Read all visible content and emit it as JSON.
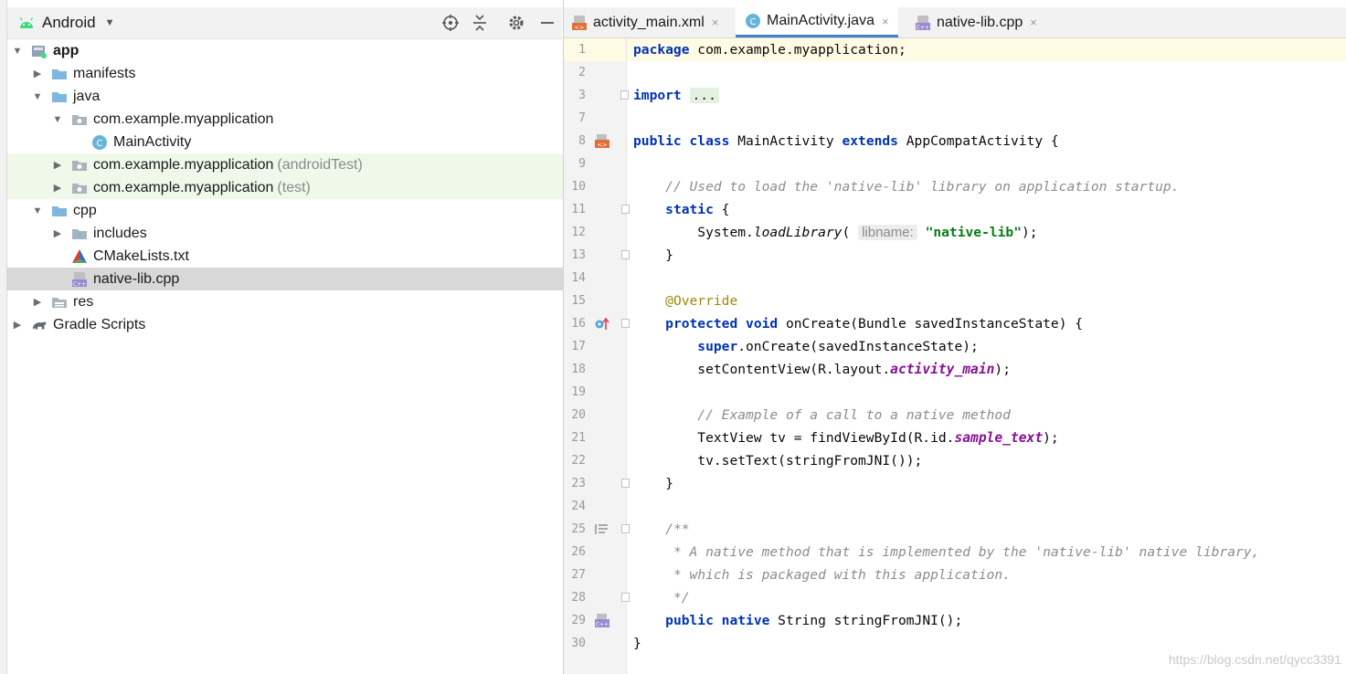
{
  "project_panel": {
    "view_mode": "Android",
    "tree": [
      {
        "label": "app",
        "suffix": "",
        "icon": "module-icon",
        "expanded": true
      },
      {
        "label": "manifests",
        "suffix": "",
        "icon": "folder-icon",
        "expanded": false
      },
      {
        "label": "java",
        "suffix": "",
        "icon": "folder-icon",
        "expanded": true
      },
      {
        "label": "com.example.myapplication",
        "suffix": "",
        "icon": "package-icon",
        "expanded": true
      },
      {
        "label": "MainActivity",
        "suffix": "",
        "icon": "class-icon"
      },
      {
        "label": "com.example.myapplication",
        "suffix": "(androidTest)",
        "icon": "package-icon",
        "expanded": false
      },
      {
        "label": "com.example.myapplication",
        "suffix": "(test)",
        "icon": "package-icon",
        "expanded": false
      },
      {
        "label": "cpp",
        "suffix": "",
        "icon": "folder-icon",
        "expanded": true
      },
      {
        "label": "includes",
        "suffix": "",
        "icon": "package-icon",
        "expanded": false
      },
      {
        "label": "CMakeLists.txt",
        "suffix": "",
        "icon": "cmake-icon"
      },
      {
        "label": "native-lib.cpp",
        "suffix": "",
        "icon": "cpp-file-icon",
        "selected": true
      },
      {
        "label": "res",
        "suffix": "",
        "icon": "res-folder-icon",
        "expanded": false
      },
      {
        "label": "Gradle Scripts",
        "suffix": "",
        "icon": "gradle-icon",
        "expanded": false
      }
    ]
  },
  "tabs": [
    {
      "label": "activity_main.xml",
      "icon": "xml-file-icon",
      "active": false,
      "close": "×"
    },
    {
      "label": "MainActivity.java",
      "icon": "class-icon",
      "active": true,
      "close": "×"
    },
    {
      "label": "native-lib.cpp",
      "icon": "cpp-file-icon",
      "active": false,
      "close": "×"
    }
  ],
  "editor": {
    "line_numbers": [
      "1",
      "2",
      "3",
      "7",
      "8",
      "9",
      "10",
      "11",
      "12",
      "13",
      "14",
      "15",
      "16",
      "17",
      "18",
      "19",
      "20",
      "21",
      "22",
      "23",
      "24",
      "25",
      "26",
      "27",
      "28",
      "29",
      "30"
    ],
    "code": {
      "package_kw": "package",
      "package_name": " com.example.myapplication;",
      "import_kw": "import",
      "import_dots": "...",
      "public_kw": "public",
      "class_kw": "class",
      "class_name": " MainActivity ",
      "extends_kw": "extends",
      "super_class": " AppCompatActivity {",
      "comment_load": "// Used to load the 'native-lib' library on application startup.",
      "static_kw": "static",
      "static_brace": " {",
      "system_call": "System.",
      "load_library": "loadLibrary",
      "paren_open": "(",
      "param_hint": "libname:",
      "lib_string": "\"native-lib\"",
      "call_close": ");",
      "close_brace": "}",
      "override_ann": "@Override",
      "protected_kw": "protected",
      "void_kw": "void",
      "oncreate_sig": " onCreate(Bundle savedInstanceState) {",
      "super_kw": "super",
      "super_call": ".onCreate(savedInstanceState);",
      "set_content": "setContentView(R.layout.",
      "activity_main": "activity_main",
      "comment_example": "// Example of a call to a native method",
      "find_view": "TextView tv = findViewById(R.id.",
      "sample_text": "sample_text",
      "set_text": "tv.setText(stringFromJNI());",
      "doc_open": "/**",
      "doc_line1": " * A native method that is implemented by the 'native-lib' native library,",
      "doc_line2": " * which is packaged with this application.",
      "doc_close": " */",
      "native_kw": "native",
      "native_sig": " String stringFromJNI();"
    }
  },
  "watermark": "https://blog.csdn.net/qycc3391"
}
